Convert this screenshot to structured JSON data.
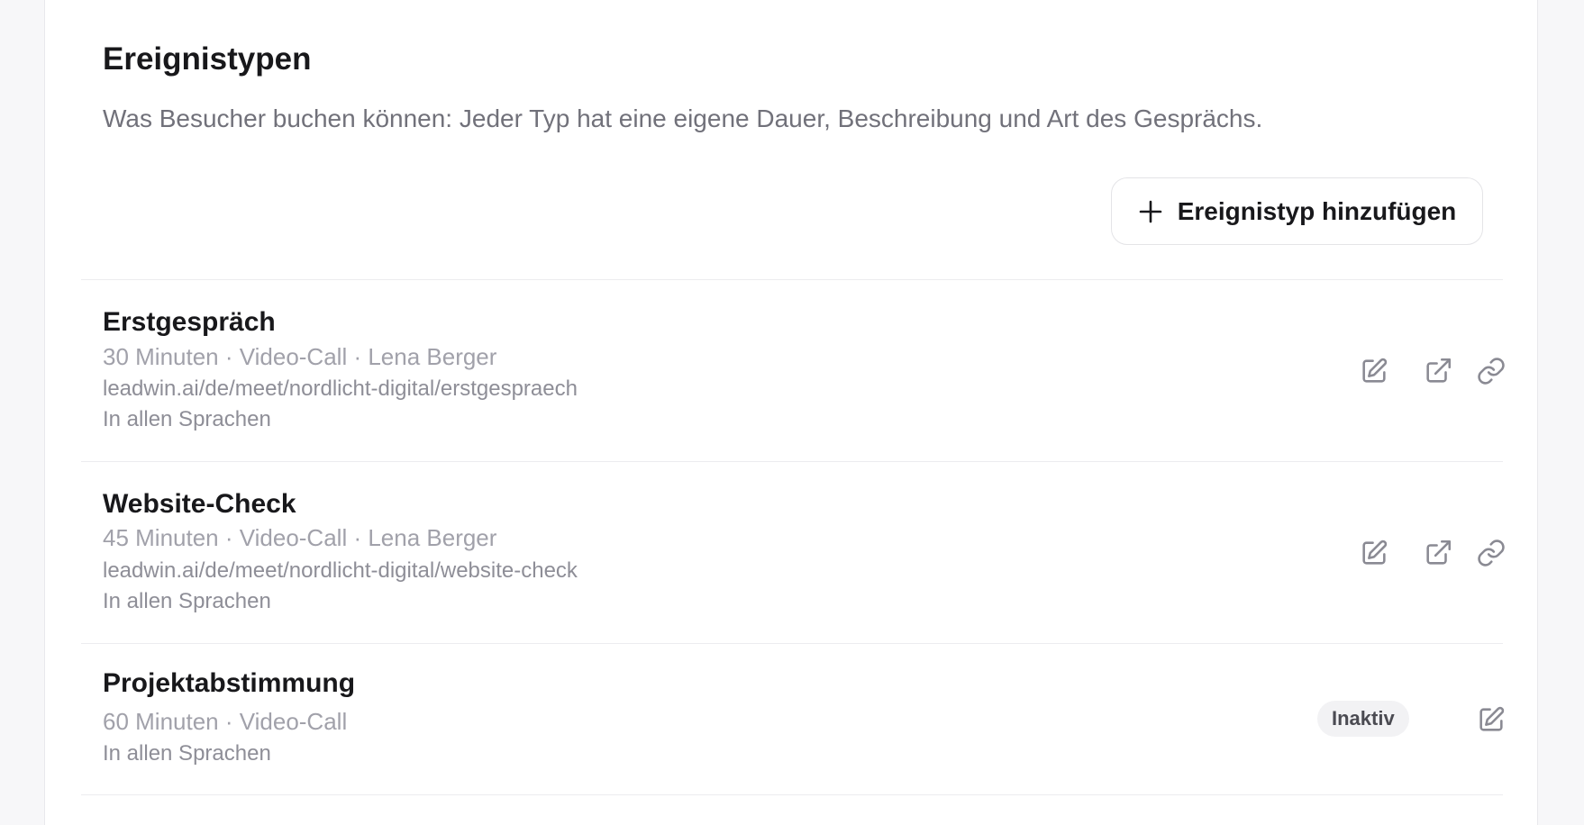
{
  "header": {
    "title": "Ereignistypen",
    "subtitle": "Was Besucher buchen können: Jeder Typ hat eine eigene Dauer, Beschreibung und Art des Gesprächs.",
    "add_button_label": "Ereignistyp hinzufügen"
  },
  "event_types": [
    {
      "name": "Erstgespräch",
      "meta": "30 Minuten · Video-Call · Lena Berger",
      "url": "leadwin.ai/de/meet/nordlicht-digital/erstgespraech",
      "languages": "In allen Sprachen"
    },
    {
      "name": "Website-Check",
      "meta": "45 Minuten · Video-Call · Lena Berger",
      "url": "leadwin.ai/de/meet/nordlicht-digital/website-check",
      "languages": "In allen Sprachen"
    },
    {
      "name": "Projektabstimmung",
      "meta": "60 Minuten · Video-Call",
      "languages": "In allen Sprachen",
      "status_badge": "Inaktiv"
    }
  ],
  "icons": [
    "plus-icon",
    "edit-icon",
    "external-link-icon",
    "link-icon"
  ],
  "colors": {
    "muted_text": "#71717a",
    "icon": "#8a8a93",
    "badge_bg": "#f2f2f4"
  }
}
